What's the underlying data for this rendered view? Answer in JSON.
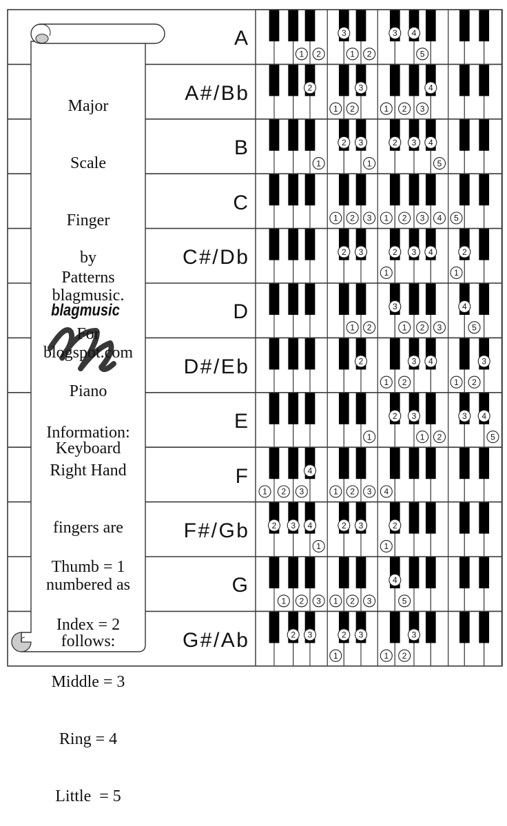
{
  "scroll": {
    "title_lines": [
      "Major",
      "Scale",
      "Finger",
      "Patterns",
      "For",
      "Piano",
      "Keyboard"
    ],
    "by_label": "by",
    "site_lines": [
      "blagmusic.",
      "blogspot.com"
    ],
    "logo_text": "blagmusic",
    "logo_icon": "scribble-m-logo",
    "info_heading": "Information:",
    "info_lines": [
      "Right Hand",
      "fingers are",
      "numbered as",
      "follows:"
    ],
    "finger_legend": [
      "Thumb = 1",
      "Index = 2",
      "Middle = 3",
      "Ring = 4",
      "Little  = 5"
    ]
  },
  "keyboard": {
    "white_keys": [
      "F1",
      "G1",
      "A1",
      "B1",
      "C2",
      "D2",
      "E2",
      "F2",
      "G2",
      "A2",
      "B2",
      "C3",
      "D3",
      "E3"
    ],
    "black_keys": [
      "F#1",
      "G#1",
      "A#1",
      "C#2",
      "D#2",
      "F#2",
      "G#2",
      "A#2",
      "C#3",
      "D#3"
    ]
  },
  "scales": [
    {
      "name": "A",
      "fingers": [
        [
          "A1",
          1
        ],
        [
          "B1",
          2
        ],
        [
          "C#2",
          3
        ],
        [
          "D2",
          1
        ],
        [
          "E2",
          2
        ],
        [
          "F#2",
          3
        ],
        [
          "G#2",
          4
        ],
        [
          "A2",
          5
        ]
      ]
    },
    {
      "name": "A#/Bb",
      "fingers": [
        [
          "A#1",
          2
        ],
        [
          "C2",
          1
        ],
        [
          "D2",
          2
        ],
        [
          "D#2",
          3
        ],
        [
          "F2",
          1
        ],
        [
          "G2",
          2
        ],
        [
          "A2",
          3
        ],
        [
          "A#2",
          4
        ]
      ]
    },
    {
      "name": "B",
      "fingers": [
        [
          "B1",
          1
        ],
        [
          "C#2",
          2
        ],
        [
          "D#2",
          3
        ],
        [
          "E2",
          1
        ],
        [
          "F#2",
          2
        ],
        [
          "G#2",
          3
        ],
        [
          "A#2",
          4
        ],
        [
          "B2",
          5
        ]
      ]
    },
    {
      "name": "C",
      "fingers": [
        [
          "C2",
          1
        ],
        [
          "D2",
          2
        ],
        [
          "E2",
          3
        ],
        [
          "F2",
          1
        ],
        [
          "G2",
          2
        ],
        [
          "A2",
          3
        ],
        [
          "B2",
          4
        ],
        [
          "C3",
          5
        ]
      ]
    },
    {
      "name": "C#/Db",
      "fingers": [
        [
          "C#2",
          2
        ],
        [
          "D#2",
          3
        ],
        [
          "F2",
          1
        ],
        [
          "F#2",
          2
        ],
        [
          "G#2",
          3
        ],
        [
          "A#2",
          4
        ],
        [
          "C3",
          1
        ],
        [
          "C#3",
          2
        ]
      ]
    },
    {
      "name": "D",
      "fingers": [
        [
          "D2",
          1
        ],
        [
          "E2",
          2
        ],
        [
          "F#2",
          3
        ],
        [
          "G2",
          1
        ],
        [
          "A2",
          2
        ],
        [
          "B2",
          3
        ],
        [
          "C#3",
          4
        ],
        [
          "D3",
          5
        ]
      ]
    },
    {
      "name": "D#/Eb",
      "fingers": [
        [
          "D#2",
          2
        ],
        [
          "F2",
          1
        ],
        [
          "G2",
          2
        ],
        [
          "G#2",
          3
        ],
        [
          "A#2",
          4
        ],
        [
          "C3",
          1
        ],
        [
          "D3",
          2
        ],
        [
          "D#3",
          3
        ]
      ]
    },
    {
      "name": "E",
      "fingers": [
        [
          "E2",
          1
        ],
        [
          "F#2",
          2
        ],
        [
          "G#2",
          3
        ],
        [
          "A2",
          1
        ],
        [
          "B2",
          2
        ],
        [
          "C#3",
          3
        ],
        [
          "D#3",
          4
        ],
        [
          "E3",
          5
        ]
      ]
    },
    {
      "name": "F",
      "fingers": [
        [
          "F1",
          1
        ],
        [
          "G1",
          2
        ],
        [
          "A1",
          3
        ],
        [
          "A#1",
          4
        ],
        [
          "C2",
          1
        ],
        [
          "D2",
          2
        ],
        [
          "E2",
          3
        ],
        [
          "F2",
          4
        ]
      ]
    },
    {
      "name": "F#/Gb",
      "fingers": [
        [
          "F#1",
          2
        ],
        [
          "G#1",
          3
        ],
        [
          "A#1",
          4
        ],
        [
          "B1",
          1
        ],
        [
          "C#2",
          2
        ],
        [
          "D#2",
          3
        ],
        [
          "F2",
          1
        ],
        [
          "F#2",
          2
        ]
      ]
    },
    {
      "name": "G",
      "fingers": [
        [
          "G1",
          1
        ],
        [
          "A1",
          2
        ],
        [
          "B1",
          3
        ],
        [
          "C2",
          1
        ],
        [
          "D2",
          2
        ],
        [
          "E2",
          3
        ],
        [
          "F#2",
          4
        ],
        [
          "G2",
          5
        ]
      ]
    },
    {
      "name": "G#/Ab",
      "fingers": [
        [
          "G#1",
          2
        ],
        [
          "A#1",
          3
        ],
        [
          "C2",
          1
        ],
        [
          "C#2",
          2
        ],
        [
          "D#2",
          3
        ],
        [
          "F2",
          1
        ],
        [
          "G2",
          2
        ],
        [
          "G#2",
          3
        ]
      ]
    }
  ],
  "colors": {
    "black_key": "#000000",
    "white_key": "#ffffff",
    "grid_line": "#3a3a3a",
    "key_divider": "#333333",
    "scroll_curl": "#cccccc",
    "text": "#111111"
  }
}
